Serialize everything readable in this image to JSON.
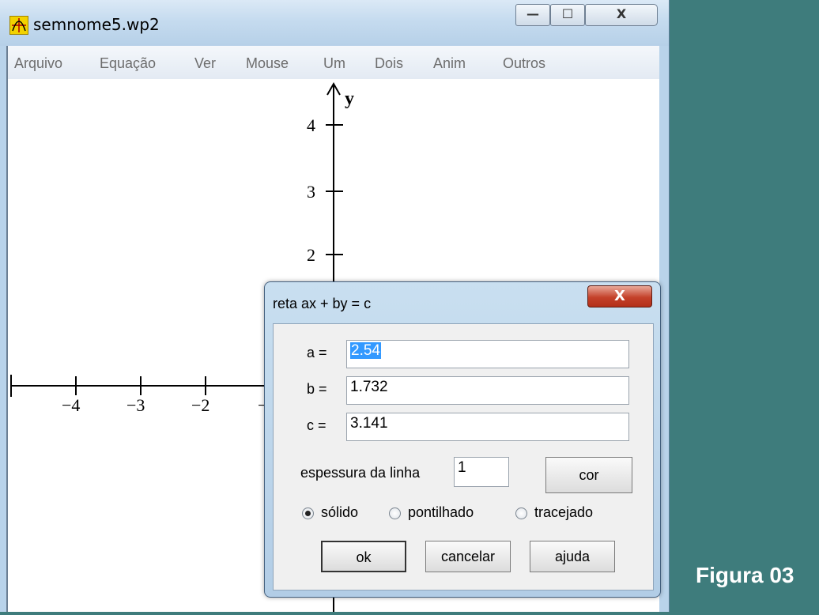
{
  "window": {
    "title": "semnome5.wp2",
    "minimize_glyph": "—",
    "maximize_glyph": "☐",
    "close_glyph": "X"
  },
  "menu": [
    "Arquivo",
    "Equação",
    "Ver",
    "Mouse",
    "Um",
    "Dois",
    "Anim",
    "Outros"
  ],
  "plot": {
    "y_label": "y",
    "y_ticks": [
      "4",
      "3",
      "2"
    ],
    "x_ticks": [
      "−4",
      "−3",
      "−2",
      "−"
    ]
  },
  "dialog": {
    "title": "reta ax + by = c",
    "close_glyph": "X",
    "a_label": "a =",
    "a_value": "2.54",
    "b_label": "b =",
    "b_value": "1.732",
    "c_label": "c =",
    "c_value": "3.141",
    "thickness_label": "espessura da linha",
    "thickness_value": "1",
    "color_button": "cor",
    "radios": [
      {
        "label": "sólido",
        "checked": true
      },
      {
        "label": "pontilhado",
        "checked": false
      },
      {
        "label": "tracejado",
        "checked": false
      }
    ],
    "ok_button": "ok",
    "cancel_button": "cancelar",
    "help_button": "ajuda"
  },
  "caption": "Figura 03",
  "colors": {
    "desktop": "#3e7c7c",
    "titlebar": "#c5dbef",
    "close_red": "#c4412a",
    "selection": "#3399ff"
  }
}
